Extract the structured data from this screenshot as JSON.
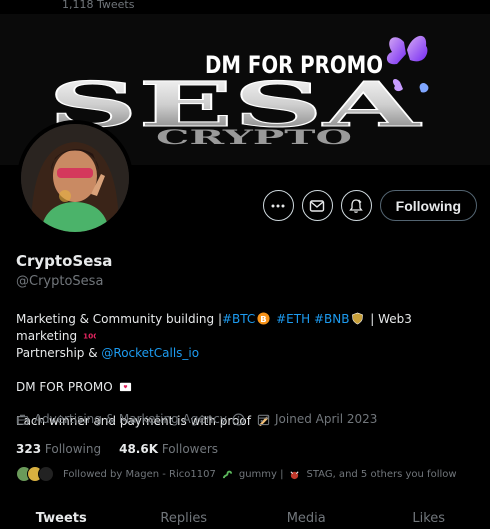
{
  "header": {
    "tweet_count": "1,118 Tweets"
  },
  "banner": {
    "promo_text": "DM FOR PROMO",
    "logo_text": "SESA",
    "sub_text": "CRYPTO",
    "butterfly_color": "#b36bff"
  },
  "actions": {
    "more_icon": "more-icon",
    "message_icon": "mail-icon",
    "notify_icon": "bell-icon",
    "follow_label": "Following"
  },
  "profile": {
    "name": "CryptoSesa",
    "handle": "@CryptoSesa",
    "bio": {
      "line1_part1": "Marketing & Community building |",
      "tag_btc": "#BTC",
      "tag_eth": "#ETH",
      "tag_bnb": "#BNB",
      "line1_part2": " | Web3 marketing",
      "line2_part1": "Partnership & ",
      "line2_link": "@RocketCalls_io",
      "line3": "DM FOR PROMO",
      "line4": "Each winner and payment is with proof"
    },
    "category": "Advertising & Marketing Agency",
    "joined": "Joined April 2023",
    "following_count": "323",
    "following_label": "Following",
    "followers_count": "48.6K",
    "followers_label": "Followers",
    "followed_by": "Followed by Magen - Rico1107",
    "followed_by_2": "gummy |",
    "followed_by_3": "STAG, and 5 others you follow"
  },
  "tabs": [
    "Tweets",
    "Replies",
    "Media",
    "Likes"
  ],
  "colors": {
    "link": "#1d9bf0",
    "muted": "#71767b",
    "text": "#e7e9ea",
    "bg": "#000000"
  }
}
